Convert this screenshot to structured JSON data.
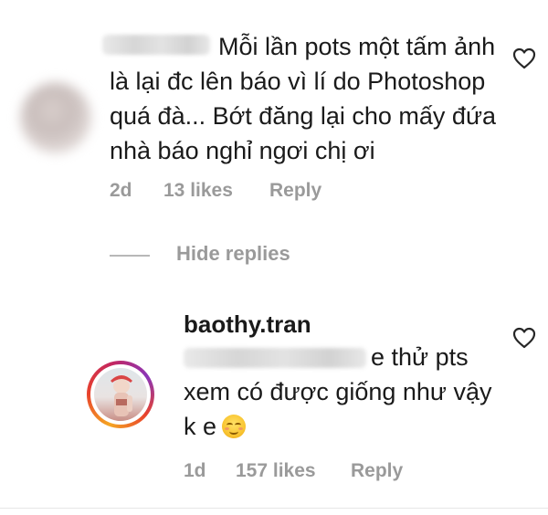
{
  "comment": {
    "text_first": "Mỗi lần pots một tấm ảnh",
    "text_rest": "là lại đc lên báo vì lí do Photoshop\nquá đà... Bớt đăng lại cho mấy đứa\nnhà báo nghỉ ngơi chị ơi",
    "time": "2d",
    "likes": "13 likes",
    "reply_label": "Reply",
    "like_icon": "heart-outline-icon"
  },
  "replies_toggle": {
    "label": "Hide replies"
  },
  "reply": {
    "username": "baothy.tran",
    "text_first": "e thử pts",
    "text_rest": "xem có được giống như vậy\nk e",
    "emoji": "smiling-face-with-smiling-eyes",
    "time": "1d",
    "likes": "157 likes",
    "reply_label": "Reply",
    "like_icon": "heart-outline-icon"
  },
  "colors": {
    "text": "#1a1a1a",
    "meta": "#9a9a9a",
    "divider": "#b8b8b8"
  }
}
